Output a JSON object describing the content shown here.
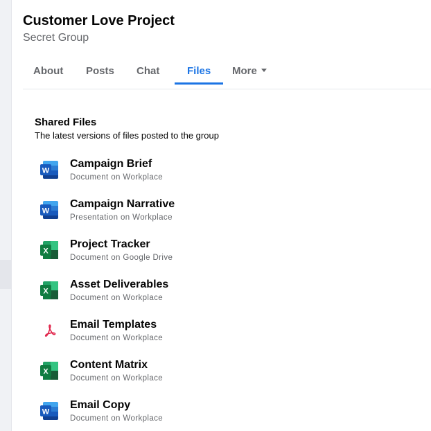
{
  "group": {
    "title": "Customer Love Project",
    "subtitle": "Secret Group"
  },
  "tabs": [
    {
      "label": "About",
      "active": false
    },
    {
      "label": "Posts",
      "active": false
    },
    {
      "label": "Chat",
      "active": false
    },
    {
      "label": "Files",
      "active": true
    },
    {
      "label": "More",
      "active": false,
      "icon": "caret-down-icon"
    }
  ],
  "shared_files": {
    "title": "Shared Files",
    "subtitle": "The latest versions of files posted to the group",
    "items": [
      {
        "name": "Campaign Brief",
        "meta": "Document on Workplace",
        "icon": "word-icon"
      },
      {
        "name": "Campaign Narrative",
        "meta": "Presentation on Workplace",
        "icon": "word-icon"
      },
      {
        "name": "Project Tracker",
        "meta": "Document on Google Drive",
        "icon": "excel-icon"
      },
      {
        "name": "Asset Deliverables",
        "meta": "Document on Workplace",
        "icon": "excel-icon"
      },
      {
        "name": "Email Templates",
        "meta": "Document on Workplace",
        "icon": "pdf-icon"
      },
      {
        "name": "Content Matrix",
        "meta": "Document on Workplace",
        "icon": "excel-icon"
      },
      {
        "name": "Email Copy",
        "meta": "Document on Workplace",
        "icon": "word-icon"
      }
    ]
  },
  "colors": {
    "accent": "#1b74e4",
    "word": "#185abd",
    "excel": "#107c41",
    "pdf": "#e0244a"
  }
}
